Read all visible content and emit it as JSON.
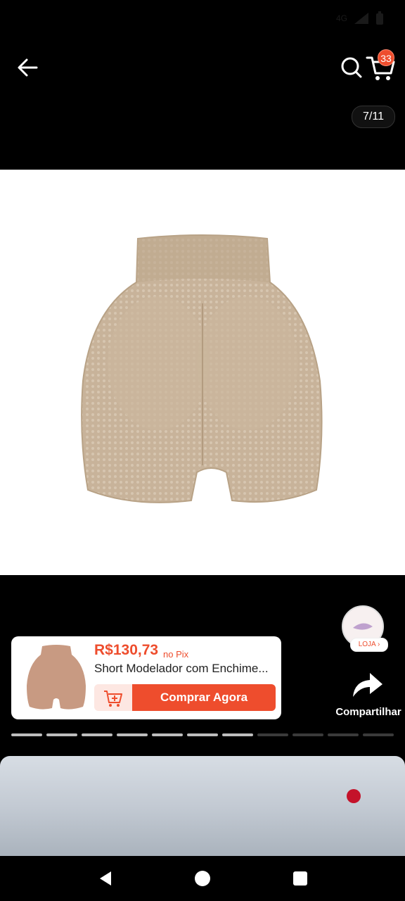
{
  "status_bar": {
    "network": "4G"
  },
  "top_bar": {
    "cart_count": "33"
  },
  "gallery": {
    "counter": "7/11",
    "current_index": 7,
    "total": 11
  },
  "side_actions": {
    "store_label": "LOJA",
    "share_label": "Compartilhar"
  },
  "product_card": {
    "price": "R$130,73",
    "price_suffix": "no Pix",
    "title": "Short Modelador com Enchime...",
    "buy_label": "Comprar Agora"
  },
  "colors": {
    "accent": "#ee4d2d",
    "background": "#000000"
  },
  "icons": [
    "back-arrow-icon",
    "search-icon",
    "cart-icon",
    "share-arrow-icon",
    "add-to-cart-icon",
    "nav-back-icon",
    "nav-home-icon",
    "nav-recents-icon"
  ]
}
